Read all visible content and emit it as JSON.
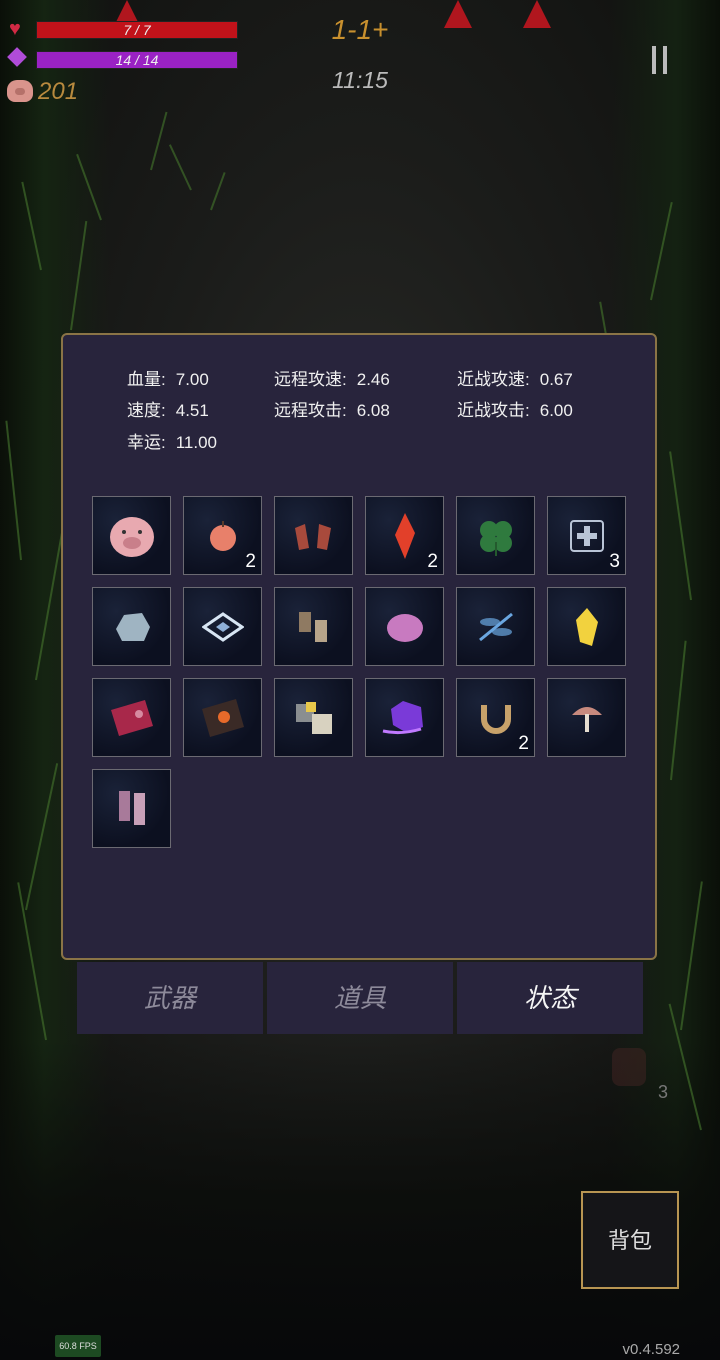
{
  "hud": {
    "hp_text": "7 / 7",
    "mp_text": "14 / 14",
    "coins": "201",
    "level": "1-1+",
    "timer": "11:15"
  },
  "stats": {
    "hp": {
      "label": "血量:",
      "value": "7.00"
    },
    "speed": {
      "label": "速度:",
      "value": "4.51"
    },
    "luck": {
      "label": "幸运:",
      "value": "11.00"
    },
    "ranged_speed": {
      "label": "远程攻速:",
      "value": "2.46"
    },
    "ranged_attack": {
      "label": "远程攻击:",
      "value": "6.08"
    },
    "melee_speed": {
      "label": "近战攻速:",
      "value": "0.67"
    },
    "melee_attack": {
      "label": "近战攻击:",
      "value": "6.00"
    }
  },
  "items": [
    {
      "icon": "piggy-bank-icon",
      "count": "",
      "color": "#e8a9b0"
    },
    {
      "icon": "apple-icon",
      "count": "2",
      "color": "#e8806a"
    },
    {
      "icon": "gloves-icon",
      "count": "",
      "color": "#a84a3c"
    },
    {
      "icon": "red-crystal-icon",
      "count": "2",
      "color": "#e2402a"
    },
    {
      "icon": "clover-icon",
      "count": "",
      "color": "#2f7a3e"
    },
    {
      "icon": "medkit-icon",
      "count": "3",
      "color": "#b9c4d6"
    },
    {
      "icon": "rock-icon",
      "count": "",
      "color": "#9fb4c2"
    },
    {
      "icon": "shield-rune-icon",
      "count": "",
      "color": "#d8e6f4"
    },
    {
      "icon": "boots-brown-icon",
      "count": "",
      "color": "#8f7a62"
    },
    {
      "icon": "pink-slime-icon",
      "count": "",
      "color": "#c87ac0"
    },
    {
      "icon": "dragonfly-icon",
      "count": "",
      "color": "#6aa6e0"
    },
    {
      "icon": "gold-crystal-icon",
      "count": "",
      "color": "#f2d23e"
    },
    {
      "icon": "red-book-icon",
      "count": "",
      "color": "#a8284a"
    },
    {
      "icon": "dark-book-icon",
      "count": "",
      "color": "#3a2a26"
    },
    {
      "icon": "cubes-icon",
      "count": "",
      "color": "#d8d2c0"
    },
    {
      "icon": "purple-snail-icon",
      "count": "",
      "color": "#7a3ad8"
    },
    {
      "icon": "horseshoe-icon",
      "count": "2",
      "color": "#c8a26a"
    },
    {
      "icon": "mushroom-icon",
      "count": "",
      "color": "#c88a7e"
    },
    {
      "icon": "pink-boots-icon",
      "count": "",
      "color": "#a87a9a"
    }
  ],
  "tabs": {
    "weapons": "武器",
    "items": "道具",
    "status": "状态"
  },
  "bag_label": "背包",
  "potion_count": "3",
  "fps": "60.8 FPS",
  "version": "v0.4.592"
}
